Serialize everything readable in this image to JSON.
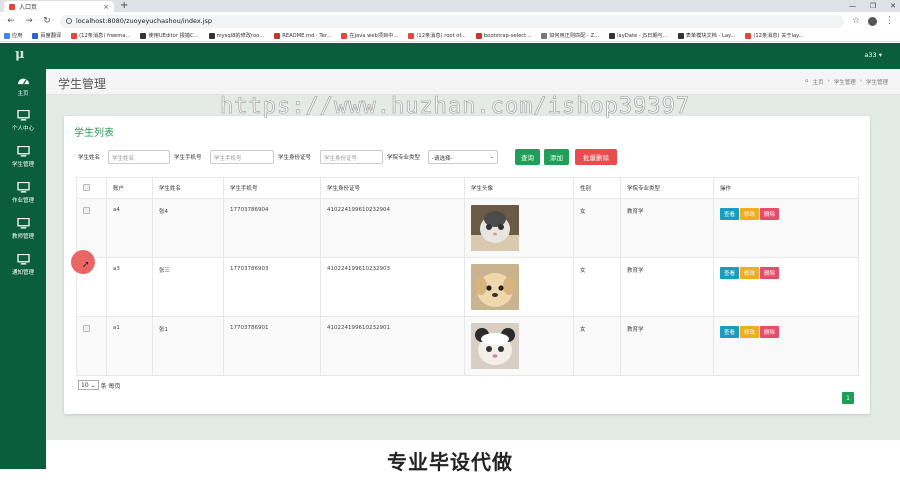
{
  "browser": {
    "tab_title": "入口页",
    "new_tab": "+",
    "url": "localhost:8080/zuoyeyuchashou/index.jsp",
    "bookmarks": [
      {
        "label": "应用",
        "color": "#4285f4"
      },
      {
        "label": "百度翻译",
        "color": "#2b63d9"
      },
      {
        "label": "(12条消息) freema...",
        "color": "#e8453c"
      },
      {
        "label": "使用UEditor 报错C...",
        "color": "#333333"
      },
      {
        "label": "mysql8的修改roo...",
        "color": "#333333"
      },
      {
        "label": "README.md · Ter...",
        "color": "#c0392b"
      },
      {
        "label": "在java web项目中...",
        "color": "#e8453c"
      },
      {
        "label": "(12条消息) root of...",
        "color": "#e8453c"
      },
      {
        "label": "bootstrap-select...",
        "color": "#c0392b"
      },
      {
        "label": "如何用正则匹配 - Z...",
        "color": "#777777"
      },
      {
        "label": "layDate - JS日期与...",
        "color": "#333333"
      },
      {
        "label": "表单模块文档 - Lay...",
        "color": "#333333"
      },
      {
        "label": "(12条消息) 关于lay...",
        "color": "#e8453c"
      }
    ]
  },
  "app": {
    "logo": "μ",
    "user": "a33 ▾"
  },
  "sidebar": {
    "items": [
      {
        "label": "主页"
      },
      {
        "label": "个人中心"
      },
      {
        "label": "学生管理"
      },
      {
        "label": "作业管理"
      },
      {
        "label": "教师管理"
      },
      {
        "label": "通知管理"
      }
    ]
  },
  "page": {
    "title": "学生管理",
    "breadcrumb": [
      "主页",
      "学生管理",
      "学生管理"
    ]
  },
  "watermark": "https://www.huzhan.com/ishop39397",
  "list": {
    "title": "学生列表",
    "filters": {
      "name_label": "学生姓名",
      "name_placeholder": "学生姓名",
      "phone_label": "学生手机号",
      "phone_placeholder": "学生手机号",
      "id_label": "学生身份证号",
      "id_placeholder": "学生身份证号",
      "major_label": "学院专业类型",
      "major_value": "-请选择-"
    },
    "buttons": {
      "search": "查询",
      "add": "添加",
      "batch_delete": "批量删除"
    },
    "columns": [
      "账户",
      "学生姓名",
      "学生手机号",
      "学生身份证号",
      "学生头像",
      "性别",
      "学院专业类型",
      "操作"
    ],
    "rows": [
      {
        "account": "a4",
        "name": "张4",
        "phone": "17703786904",
        "idcard": "410224199610232904",
        "gender": "女",
        "major": "教育学"
      },
      {
        "account": "a3",
        "name": "张三",
        "phone": "17703786903",
        "idcard": "410224199610232903",
        "gender": "女",
        "major": "教育学"
      },
      {
        "account": "a1",
        "name": "张1",
        "phone": "17703786901",
        "idcard": "410224199610232901",
        "gender": "女",
        "major": "教育学"
      }
    ],
    "ops": {
      "view": "查看",
      "edit": "修改",
      "delete": "删除"
    },
    "page_size": "10",
    "page_size_suffix": "条 每页",
    "current_page": "1"
  },
  "banner": "专业毕设代做",
  "colors": {
    "brand": "#0b5e3b",
    "accent": "#1e9e56",
    "danger": "#e84c4c"
  }
}
